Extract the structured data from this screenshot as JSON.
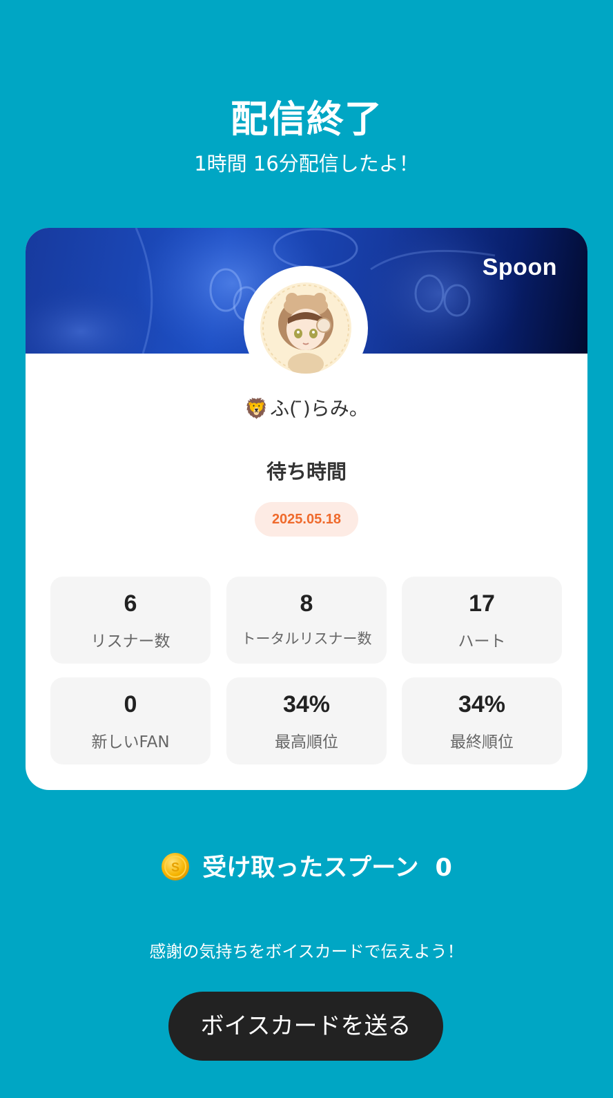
{
  "header": {
    "title": "配信終了",
    "subtitle": "1時間 16分配信したよ！"
  },
  "card": {
    "logo_text": "Spoon",
    "username_emoji": "🦁",
    "username": "ふ( ̄)らみ。",
    "heading": "待ち時間",
    "date": "2025.05.18",
    "stats": [
      {
        "value": "6",
        "label": "リスナー数"
      },
      {
        "value": "8",
        "label": "トータルリスナー数"
      },
      {
        "value": "17",
        "label": "ハート"
      },
      {
        "value": "0",
        "label": "新しいFAN"
      },
      {
        "value": "34%",
        "label": "最高順位"
      },
      {
        "value": "34%",
        "label": "最終順位"
      }
    ]
  },
  "spoons": {
    "label": "受け取ったスプーン",
    "count": "0",
    "icon": "coin-icon"
  },
  "footer": {
    "thanks_text": "感謝の気持ちをボイスカードで伝えよう！",
    "button_label": "ボイスカードを送る"
  },
  "colors": {
    "background": "#00a6c4",
    "date_accent": "#ef6a2c",
    "button": "#222222"
  }
}
